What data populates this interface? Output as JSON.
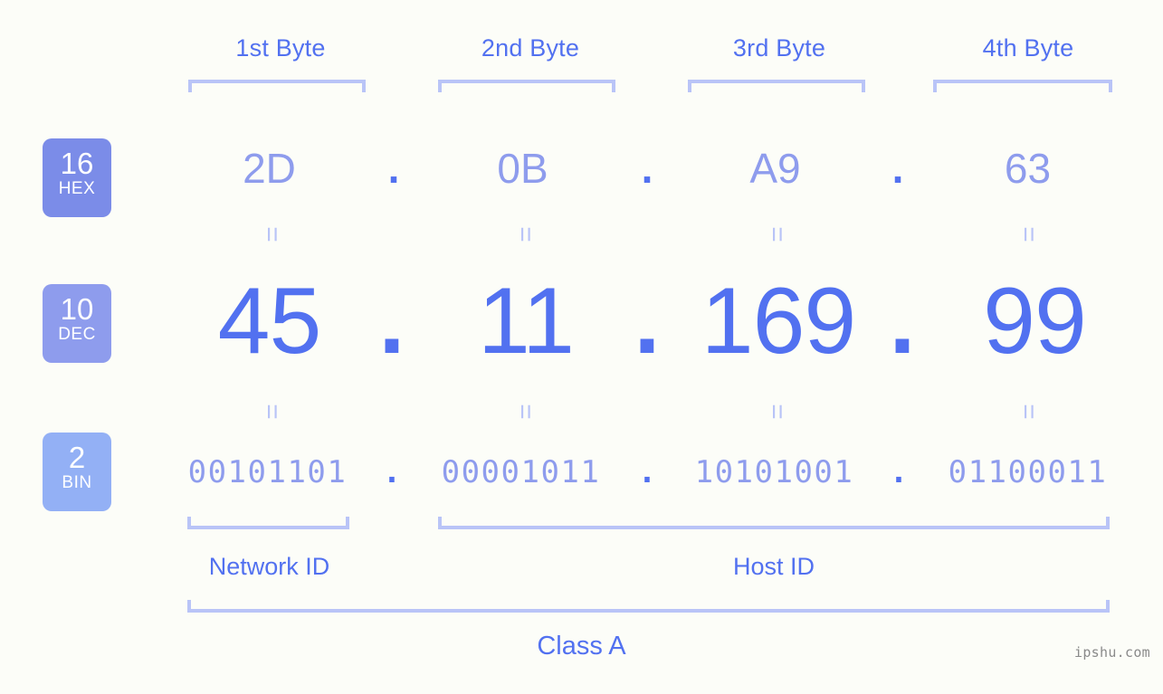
{
  "background_color": "#fcfdf8",
  "accent_color": "#5271f0",
  "muted_accent_color": "#8e9ced",
  "bracket_color": "#b9c4f7",
  "ip_address": "45.11.169.99",
  "byte_headers": [
    {
      "label": "1st Byte"
    },
    {
      "label": "2nd Byte"
    },
    {
      "label": "3rd Byte"
    },
    {
      "label": "4th Byte"
    }
  ],
  "rows": {
    "hex": {
      "base_number": "16",
      "base_name": "HEX",
      "badge_color": "#7b8ce8",
      "values": [
        "2D",
        "0B",
        "A9",
        "63"
      ],
      "separator": "."
    },
    "dec": {
      "base_number": "10",
      "base_name": "DEC",
      "badge_color": "#8e9ced",
      "values": [
        "45",
        "11",
        "169",
        "99"
      ],
      "separator": "."
    },
    "bin": {
      "base_number": "2",
      "base_name": "BIN",
      "badge_color": "#93b0f5",
      "values": [
        "00101101",
        "00001011",
        "10101001",
        "01100011"
      ],
      "separator": "."
    }
  },
  "equality_symbol": "=",
  "segments": {
    "network_id": "Network ID",
    "host_id": "Host ID"
  },
  "class_label": "Class A",
  "watermark": "ipshu.com"
}
